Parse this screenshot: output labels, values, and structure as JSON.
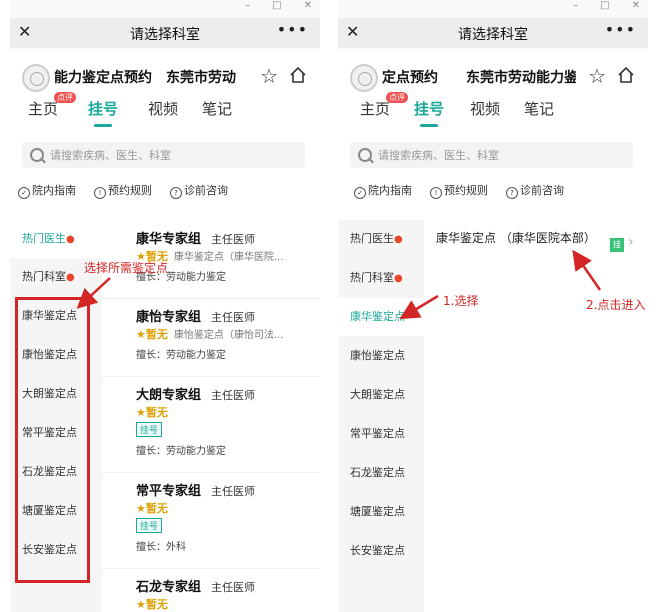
{
  "window": {
    "minimize": "–",
    "maximize": "□",
    "close": "✕"
  },
  "left": {
    "title": "请选择科室",
    "close_icon": "✕",
    "more_icon": "•••",
    "org_name": "能力鉴定点预约",
    "org_name2": "东莞市劳动",
    "tabs": [
      {
        "label": "主页",
        "badge": "点评"
      },
      {
        "label": "挂号"
      },
      {
        "label": "视频"
      },
      {
        "label": "笔记"
      }
    ],
    "search_placeholder": "请搜索疾病、医生、科室",
    "links": [
      "院内指南",
      "预约规则",
      "诊前咨询"
    ],
    "sidebar": [
      "热门医生",
      "热门科室",
      "康华鉴定点",
      "康怡鉴定点",
      "大朗鉴定点",
      "常平鉴定点",
      "石龙鉴定点",
      "塘厦鉴定点",
      "长安鉴定点"
    ],
    "doctors": [
      {
        "name": "康华专家组",
        "title": "主任医师",
        "rating": "暂无",
        "org": "康华鉴定点（康华医院...",
        "specialty": "擅长：劳动能力鉴定"
      },
      {
        "name": "康怡专家组",
        "title": "主任医师",
        "rating": "暂无",
        "org": "康怡鉴定点（康怡司法...",
        "specialty": "擅长：劳动能力鉴定"
      },
      {
        "name": "大朗专家组",
        "title": "主任医师",
        "rating": "暂无",
        "tag": "挂号",
        "specialty": "擅长：劳动能力鉴定"
      },
      {
        "name": "常平专家组",
        "title": "主任医师",
        "rating": "暂无",
        "tag": "挂号",
        "specialty": "擅长：外科"
      },
      {
        "name": "石龙专家组",
        "title": "主任医师",
        "rating": "暂无"
      }
    ],
    "annotation": "选择所需鉴定点"
  },
  "right": {
    "title": "请选择科室",
    "close_icon": "✕",
    "more_icon": "•••",
    "org_name": "定点预约",
    "org_name2": "东莞市劳动能力鉴",
    "tabs": [
      {
        "label": "主页",
        "badge": "点评"
      },
      {
        "label": "挂号"
      },
      {
        "label": "视频"
      },
      {
        "label": "笔记"
      }
    ],
    "search_placeholder": "请搜索疾病、医生、科室",
    "links": [
      "院内指南",
      "预约规则",
      "诊前咨询"
    ],
    "sidebar": [
      "热门医生",
      "热门科室",
      "康华鉴定点",
      "康怡鉴定点",
      "大朗鉴定点",
      "常平鉴定点",
      "石龙鉴定点",
      "塘厦鉴定点",
      "长安鉴定点"
    ],
    "location": "康华鉴定点 （康华医院本部）",
    "location_tag": "挂",
    "annotation1": "1.选择",
    "annotation2": "2.点击进入"
  },
  "colors": {
    "accent": "#1aa89b",
    "annotation": "#d32525",
    "rating": "#e0a000"
  }
}
